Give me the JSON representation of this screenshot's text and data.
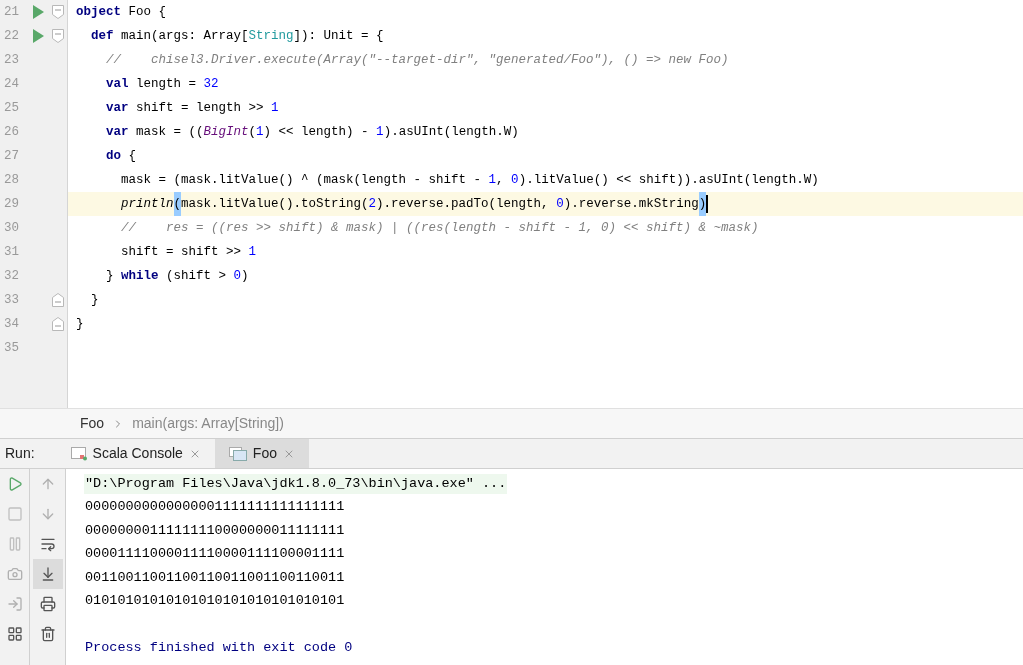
{
  "editor": {
    "lines": [
      {
        "number": "21",
        "run": true,
        "fold": true,
        "current": false,
        "tokens": [
          {
            "kind": "keyword",
            "text": "object"
          },
          {
            "kind": "plain",
            "text": " Foo {"
          }
        ]
      },
      {
        "number": "22",
        "run": true,
        "fold": true,
        "current": false,
        "tokens": [
          {
            "kind": "keyword",
            "text": "  def"
          },
          {
            "kind": "plain",
            "text": " main(args: Array["
          },
          {
            "kind": "type",
            "text": "String"
          },
          {
            "kind": "plain",
            "text": "]): Unit = {"
          }
        ]
      },
      {
        "number": "23",
        "run": false,
        "fold": false,
        "current": false,
        "tokens": [
          {
            "kind": "comment",
            "text": "    //    chisel3.Driver.execute(Array(\"--target-dir\", \"generated/Foo\"), () => new Foo)"
          }
        ]
      },
      {
        "number": "24",
        "run": false,
        "fold": false,
        "current": false,
        "tokens": [
          {
            "kind": "keyword",
            "text": "    val"
          },
          {
            "kind": "plain",
            "text": " length = "
          },
          {
            "kind": "number",
            "text": "32"
          }
        ]
      },
      {
        "number": "25",
        "run": false,
        "fold": false,
        "current": false,
        "tokens": [
          {
            "kind": "keyword",
            "text": "    var"
          },
          {
            "kind": "plain",
            "text": " shift = length >> "
          },
          {
            "kind": "number",
            "text": "1"
          }
        ]
      },
      {
        "number": "26",
        "run": false,
        "fold": false,
        "current": false,
        "tokens": [
          {
            "kind": "keyword",
            "text": "    var"
          },
          {
            "kind": "plain",
            "text": " mask = (("
          },
          {
            "kind": "object",
            "text": "BigInt"
          },
          {
            "kind": "plain",
            "text": "("
          },
          {
            "kind": "number",
            "text": "1"
          },
          {
            "kind": "plain",
            "text": ") << length) - "
          },
          {
            "kind": "number",
            "text": "1"
          },
          {
            "kind": "plain",
            "text": ").asUInt(length.W)"
          }
        ]
      },
      {
        "number": "27",
        "run": false,
        "fold": false,
        "current": false,
        "tokens": [
          {
            "kind": "keyword",
            "text": "    do"
          },
          {
            "kind": "plain",
            "text": " {"
          }
        ]
      },
      {
        "number": "28",
        "run": false,
        "fold": false,
        "current": false,
        "tokens": [
          {
            "kind": "plain",
            "text": "      mask = (mask.litValue() ^ (mask(length - shift - "
          },
          {
            "kind": "number",
            "text": "1"
          },
          {
            "kind": "plain",
            "text": ", "
          },
          {
            "kind": "number",
            "text": "0"
          },
          {
            "kind": "plain",
            "text": ").litValue() << shift)).asUInt(length.W)"
          }
        ]
      },
      {
        "number": "29",
        "run": false,
        "fold": false,
        "current": true,
        "tokens": [
          {
            "kind": "call",
            "text": "      println"
          },
          {
            "kind": "match",
            "text": "("
          },
          {
            "kind": "plain",
            "text": "mask.litValue().toString("
          },
          {
            "kind": "number",
            "text": "2"
          },
          {
            "kind": "plain",
            "text": ").reverse.padTo(length, "
          },
          {
            "kind": "number",
            "text": "0"
          },
          {
            "kind": "plain",
            "text": ").reverse.mkString"
          },
          {
            "kind": "match",
            "text": ")"
          }
        ]
      },
      {
        "number": "30",
        "run": false,
        "fold": false,
        "current": false,
        "tokens": [
          {
            "kind": "comment",
            "text": "      //    res = ((res >> shift) & mask) | ((res(length - shift - 1, 0) << shift) & ~mask)"
          }
        ]
      },
      {
        "number": "31",
        "run": false,
        "fold": false,
        "current": false,
        "tokens": [
          {
            "kind": "plain",
            "text": "      shift = shift >> "
          },
          {
            "kind": "number",
            "text": "1"
          }
        ]
      },
      {
        "number": "32",
        "run": false,
        "fold": false,
        "current": false,
        "tokens": [
          {
            "kind": "plain",
            "text": "    } "
          },
          {
            "kind": "keyword",
            "text": "while"
          },
          {
            "kind": "plain",
            "text": " (shift > "
          },
          {
            "kind": "number",
            "text": "0"
          },
          {
            "kind": "plain",
            "text": ")"
          }
        ]
      },
      {
        "number": "33",
        "run": false,
        "fold": true,
        "current": false,
        "tokens": [
          {
            "kind": "plain",
            "text": "  }"
          }
        ]
      },
      {
        "number": "34",
        "run": false,
        "fold": true,
        "current": false,
        "tokens": [
          {
            "kind": "plain",
            "text": "}"
          }
        ]
      },
      {
        "number": "35",
        "run": false,
        "fold": false,
        "current": false
      }
    ]
  },
  "breadcrumbs": [
    "Foo",
    "main(args: Array[String])"
  ],
  "run_panel": {
    "label": "Run:",
    "tabs": [
      {
        "label": "Scala Console",
        "selected": false
      },
      {
        "label": "Foo",
        "selected": true
      }
    ],
    "scroll_to_end": true,
    "output": [
      {
        "kind": "command",
        "text": "\"D:\\Program Files\\Java\\jdk1.8.0_73\\bin\\java.exe\" ..."
      },
      {
        "kind": "stdout",
        "text": "00000000000000001111111111111111"
      },
      {
        "kind": "stdout",
        "text": "00000000111111110000000011111111"
      },
      {
        "kind": "stdout",
        "text": "00001111000011110000111100001111"
      },
      {
        "kind": "stdout",
        "text": "00110011001100110011001100110011"
      },
      {
        "kind": "stdout",
        "text": "01010101010101010101010101010101"
      },
      {
        "kind": "system",
        "text": "Process finished with exit code 0"
      }
    ]
  }
}
